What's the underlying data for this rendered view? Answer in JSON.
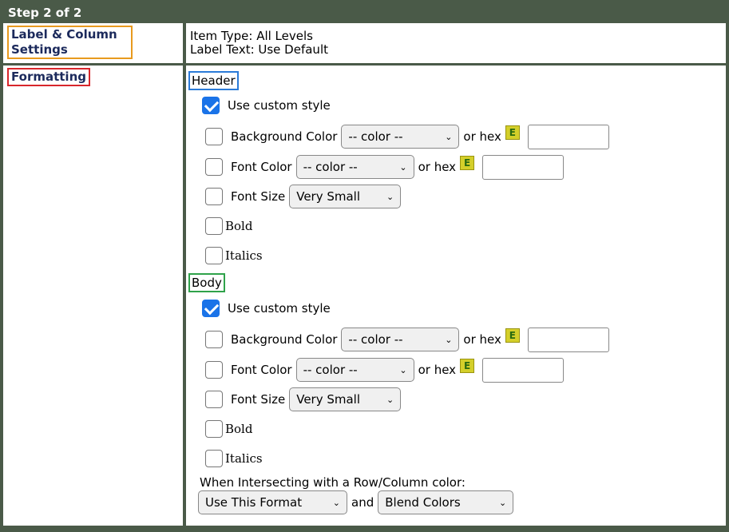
{
  "title": "Step 2 of 2",
  "label_column_settings": {
    "label": "Label & Column Settings",
    "item_type": "Item Type: All Levels",
    "label_text": "Label Text: Use Default"
  },
  "formatting": {
    "label": "Formatting",
    "header": {
      "label": "Header",
      "use_custom_style": "Use custom style",
      "use_custom_style_checked": true,
      "background_color_label": "Background Color",
      "color_select_value": "-- color --",
      "or_hex": "or hex",
      "e_button": "E",
      "font_color_label": "Font Color",
      "font_size_label": "Font Size",
      "font_size_value": "Very Small",
      "bold_label": "Bold",
      "italics_label": "Italics"
    },
    "body": {
      "label": "Body",
      "use_custom_style": "Use custom style",
      "use_custom_style_checked": true,
      "background_color_label": "Background Color",
      "color_select_value": "-- color --",
      "or_hex": "or hex",
      "e_button": "E",
      "font_color_label": "Font Color",
      "font_size_label": "Font Size",
      "font_size_value": "Very Small",
      "bold_label": "Bold",
      "italics_label": "Italics"
    },
    "intersect": {
      "label": "When Intersecting with a Row/Column color:",
      "format_value": "Use This Format",
      "and_label": "and",
      "blend_value": "Blend Colors"
    }
  },
  "colors": {
    "frame": "#4a5a48",
    "checkbox_checked": "#1a73e8",
    "label_text": "#1c2a5c"
  }
}
